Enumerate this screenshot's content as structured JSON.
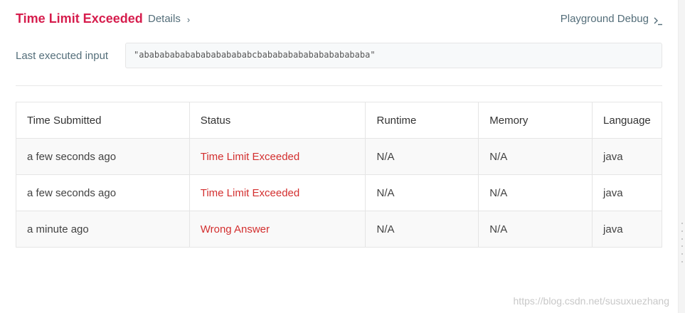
{
  "header": {
    "status_title": "Time Limit Exceeded",
    "details_label": "Details",
    "playground_label": "Playground Debug"
  },
  "last_executed": {
    "label": "Last executed input",
    "value": "\"abababababababababababcbababababababababababa\""
  },
  "table": {
    "headers": {
      "time": "Time Submitted",
      "status": "Status",
      "runtime": "Runtime",
      "memory": "Memory",
      "language": "Language"
    },
    "rows": [
      {
        "time": "a few seconds ago",
        "status": "Time Limit Exceeded",
        "runtime": "N/A",
        "memory": "N/A",
        "language": "java"
      },
      {
        "time": "a few seconds ago",
        "status": "Time Limit Exceeded",
        "runtime": "N/A",
        "memory": "N/A",
        "language": "java"
      },
      {
        "time": "a minute ago",
        "status": "Wrong Answer",
        "runtime": "N/A",
        "memory": "N/A",
        "language": "java"
      }
    ]
  },
  "watermark": "https://blog.csdn.net/susuxuezhang",
  "colors": {
    "status_error": "#d61d4d",
    "status_cell": "#d32f2f",
    "link": "#546e7a"
  },
  "icons": {
    "details": "chevron-right-icon",
    "playground": "terminal-icon"
  }
}
